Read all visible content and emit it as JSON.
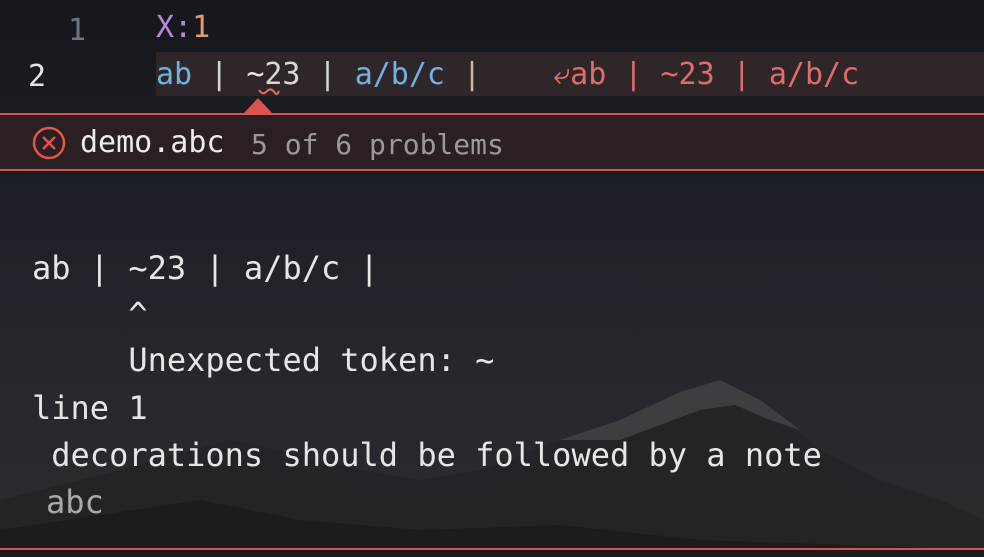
{
  "editor": {
    "line_numbers": [
      "1",
      "2"
    ],
    "line1": {
      "key": "X",
      "sep": ":",
      "num": "1"
    },
    "line2": {
      "a": "ab",
      "bar1": " | ",
      "tilde": "~",
      "num": "23",
      "bar2": " | ",
      "fraction": "a/b/c",
      "bar3": " |",
      "inline_diagnostic": "⤶ab | ~23 | a/b/c"
    }
  },
  "peek": {
    "file": "demo.abc",
    "problems": "5 of 6 problems",
    "message_lines": [
      "ab | ~23 | a/b/c |",
      "     ^",
      "     Unexpected token: ~",
      "line 1",
      " decorations should be followed by a note"
    ],
    "source": "abc"
  },
  "colors": {
    "error": "#d9534f",
    "note": "#6fb3e0",
    "header_key": "#b78ad6"
  },
  "icons": {
    "error": "error-circle-x-icon"
  }
}
